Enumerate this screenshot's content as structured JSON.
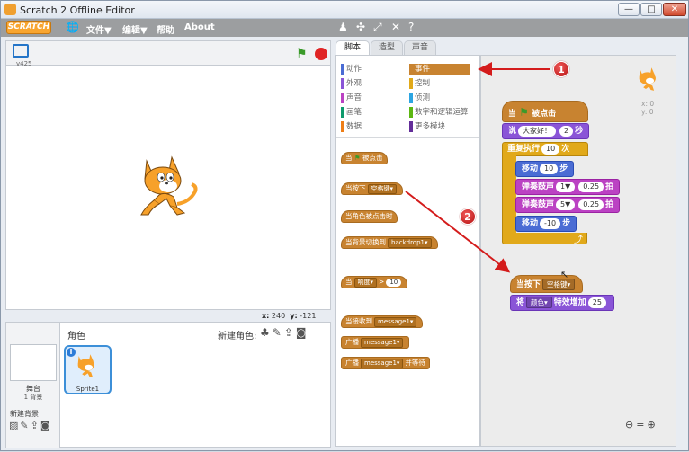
{
  "window": {
    "title": "Scratch 2 Offline Editor",
    "controls": [
      "—",
      "□",
      "✕"
    ]
  },
  "menubar": {
    "logo": "SCRATCH",
    "items": [
      "文件▼",
      "编辑▼",
      "帮助",
      "About"
    ],
    "tool_icons": [
      "stamp-icon",
      "cut-icon",
      "grow-icon",
      "shrink-icon",
      "help-icon"
    ]
  },
  "stage": {
    "version": "v425",
    "mouse_x_label": "x:",
    "mouse_x": "240",
    "mouse_y_label": "y:",
    "mouse_y": "-121"
  },
  "sprites": {
    "header": "角色",
    "new_sprite_label": "新建角色:",
    "stage_label": "舞台",
    "backdrop_count": "1 背景",
    "new_backdrop_label": "新建背景",
    "items": [
      {
        "name": "Sprite1"
      }
    ]
  },
  "tabs": [
    {
      "label": "脚本"
    },
    {
      "label": "造型"
    },
    {
      "label": "声音"
    }
  ],
  "categories": [
    {
      "label": "动作",
      "color": "#4a6cd4"
    },
    {
      "label": "事件",
      "color": "#c88330",
      "selected": true
    },
    {
      "label": "外观",
      "color": "#8a55d7"
    },
    {
      "label": "控制",
      "color": "#e1a91a"
    },
    {
      "label": "声音",
      "color": "#bb42c3"
    },
    {
      "label": "侦测",
      "color": "#2ca5e2"
    },
    {
      "label": "画笔",
      "color": "#0e9a6c"
    },
    {
      "label": "数字和逻辑运算",
      "color": "#5cb712"
    },
    {
      "label": "数据",
      "color": "#ee7d16"
    },
    {
      "label": "更多模块",
      "color": "#632d99"
    }
  ],
  "palette_blocks": {
    "flag_hat": {
      "pre": "当",
      "post": "被点击"
    },
    "key_hat": {
      "pre": "当按下",
      "key": "空格键"
    },
    "sprite_click": "当角色被点击时",
    "backdrop_switch": {
      "pre": "当背景切换到",
      "value": "backdrop1"
    },
    "sensor": {
      "pre": "当",
      "dropdown": "响度",
      "op": ">",
      "value": "10"
    },
    "receive": {
      "pre": "当接收到",
      "value": "message1"
    },
    "broadcast": {
      "pre": "广播",
      "value": "message1"
    },
    "broadcast_wait": {
      "pre": "广播",
      "value": "message1",
      "post": "并等待"
    }
  },
  "script1": {
    "hat": {
      "pre": "当",
      "post": "被点击"
    },
    "say": {
      "pre": "说",
      "text": "大家好！",
      "secs": "2",
      "post": "秒"
    },
    "forever": {
      "pre": "重复执行",
      "count": "10",
      "post": "次"
    },
    "move1": {
      "pre": "移动",
      "steps": "10",
      "post": "步"
    },
    "drum1": {
      "pre": "弹奏鼓声",
      "drum": "1▼",
      "beats": "0.25",
      "post": "拍"
    },
    "drum2": {
      "pre": "弹奏鼓声",
      "drum": "5▼",
      "beats": "0.25",
      "post": "拍"
    },
    "move2": {
      "pre": "移动",
      "steps": "-10",
      "post": "步"
    },
    "loop_arrow": "⤴"
  },
  "script2": {
    "hat": {
      "pre": "当按下",
      "key": "空格键"
    },
    "effect": {
      "pre": "将",
      "effect": "颜色",
      "post": "特效增加",
      "value": "25"
    }
  },
  "sprite_xy": {
    "x": "x: 0",
    "y": "y: 0"
  },
  "zoom": [
    "zoom-out-icon",
    "zoom-reset-icon",
    "zoom-in-icon"
  ],
  "annotations": [
    {
      "label": "1"
    },
    {
      "label": "2"
    }
  ],
  "colors": {
    "events": "#c88330",
    "looks": "#8a55d7",
    "control": "#e1a91a",
    "motion": "#4a6cd4",
    "sound": "#bb42c3",
    "annotation": "#d41c1c"
  }
}
